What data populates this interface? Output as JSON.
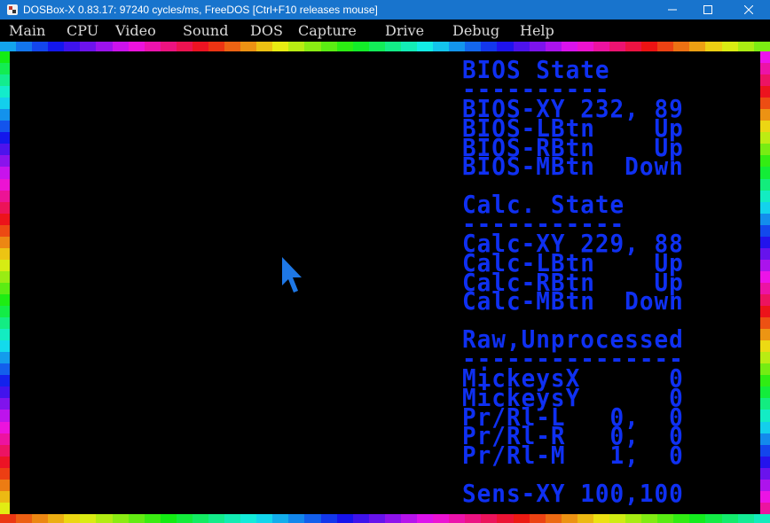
{
  "window": {
    "title": "DOSBox-X 0.83.17: 97240 cycles/ms, FreeDOS [Ctrl+F10 releases mouse]",
    "controls": [
      "minimize-icon",
      "maximize-icon",
      "close-icon"
    ]
  },
  "menubar": {
    "items": [
      "Main",
      "CPU",
      "Video",
      "Sound",
      "DOS",
      "Capture",
      "Drive",
      "Debug",
      "Help"
    ]
  },
  "screen": {
    "lines": [
      "BIOS State",
      "----------",
      "BIOS-XY 232, 89",
      "BIOS-LBtn    Up",
      "BIOS-RBtn    Up",
      "BIOS-MBtn  Down",
      "Calc. State",
      "-----------",
      "Calc-XY 229, 88",
      "Calc-LBtn    Up",
      "Calc-RBtn    Up",
      "Calc-MBtn  Down",
      "Raw,Unprocessed",
      "---------------",
      "MickeysX      0",
      "MickeysY      0",
      "Pr/Rl-L   0,  0",
      "Pr/Rl-R   0,  0",
      "Pr/Rl-M   1,  0",
      "Sens-XY 100,100"
    ]
  },
  "colors": {
    "titlebar": "#1874cd",
    "text": "#0f30f2",
    "cursor": "#1e78e6"
  }
}
